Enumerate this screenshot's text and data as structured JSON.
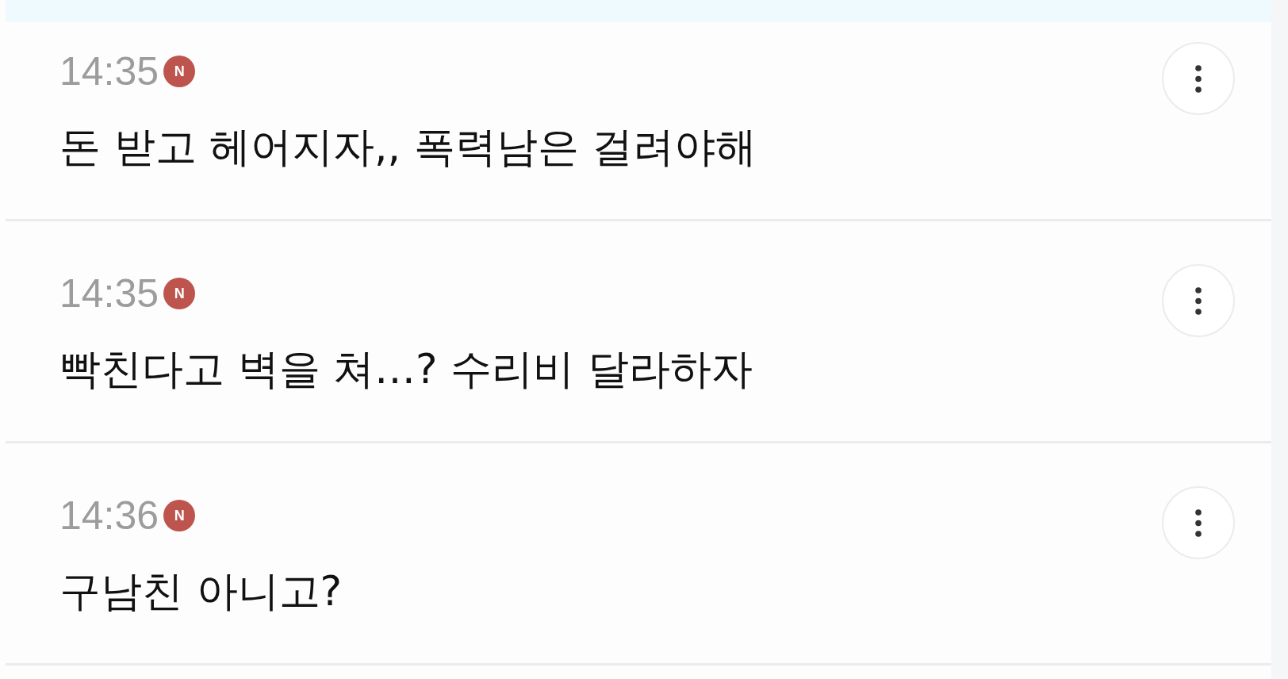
{
  "comments": [
    {
      "time": "14:35",
      "badge": "N",
      "text": "돈 받고 헤어지자,, 폭력남은 걸려야해"
    },
    {
      "time": "14:35",
      "badge": "N",
      "text": "빡친다고 벽을 쳐…? 수리비 달라하자"
    },
    {
      "time": "14:36",
      "badge": "N",
      "text": "구남친 아니고?"
    }
  ]
}
